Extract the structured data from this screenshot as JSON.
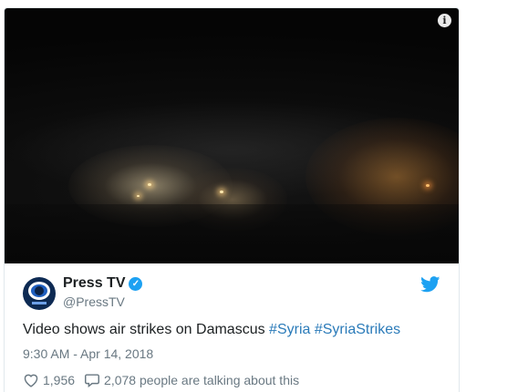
{
  "media": {
    "info_icon": "info-icon",
    "info_glyph": "i"
  },
  "tweet": {
    "author": {
      "display_name": "Press TV",
      "screen_name": "@PressTV",
      "verified": true,
      "verified_glyph": "✓"
    },
    "text": "Video shows air strikes on Damascus",
    "hashtags": [
      "#Syria",
      "#SyriaStrikes"
    ],
    "timestamp": "9:30 AM - Apr 14, 2018",
    "likes": "1,956",
    "replies_text": "2,078 people are talking about this"
  },
  "colors": {
    "hashtag": "#2b7bb9",
    "twitter_blue": "#1da1f2",
    "muted_text": "#697882"
  }
}
